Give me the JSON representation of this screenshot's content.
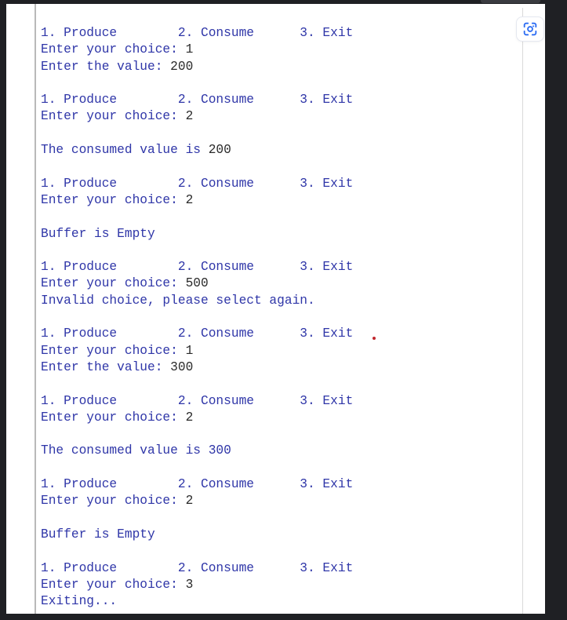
{
  "terminal": {
    "lines": [
      {
        "text": "1. Produce        2. Consume      3. Exit"
      },
      {
        "prefix": "Enter your choice: ",
        "value": "1"
      },
      {
        "prefix": "Enter the value: ",
        "value": "200"
      },
      {
        "text": ""
      },
      {
        "text": "1. Produce        2. Consume      3. Exit"
      },
      {
        "prefix": "Enter your choice: ",
        "value": "2"
      },
      {
        "text": ""
      },
      {
        "prefix": "The consumed value is ",
        "value": "200"
      },
      {
        "text": ""
      },
      {
        "text": "1. Produce        2. Consume      3. Exit"
      },
      {
        "prefix": "Enter your choice: ",
        "value": "2"
      },
      {
        "text": ""
      },
      {
        "text": "Buffer is Empty"
      },
      {
        "text": ""
      },
      {
        "text": "1. Produce        2. Consume      3. Exit"
      },
      {
        "prefix": "Enter your choice: ",
        "value": "500"
      },
      {
        "text": "Invalid choice, please select again."
      },
      {
        "text": ""
      },
      {
        "text": "1. Produce        2. Consume      3. Exit"
      },
      {
        "prefix": "Enter your choice: ",
        "value": "1"
      },
      {
        "prefix": "Enter the value: ",
        "value": "300"
      },
      {
        "text": ""
      },
      {
        "text": "1. Produce        2. Consume      3. Exit"
      },
      {
        "prefix": "Enter your choice: ",
        "value": "2"
      },
      {
        "text": ""
      },
      {
        "text": "The consumed value is 300"
      },
      {
        "text": ""
      },
      {
        "text": "1. Produce        2. Consume      3. Exit"
      },
      {
        "prefix": "Enter your choice: ",
        "value": "2"
      },
      {
        "text": ""
      },
      {
        "text": "Buffer is Empty"
      },
      {
        "text": ""
      },
      {
        "text": "1. Produce        2. Consume      3. Exit"
      },
      {
        "prefix": "Enter your choice: ",
        "value": "3"
      },
      {
        "text": "Exiting..."
      }
    ]
  },
  "lens_button": {
    "icon": "lens-scan-icon"
  },
  "colors": {
    "program_text": "#2f36a8",
    "user_input": "#2b2b2b",
    "page_background": "#ffffff",
    "outer_background": "#1f2024",
    "lens_icon": "#2b6cf3"
  }
}
